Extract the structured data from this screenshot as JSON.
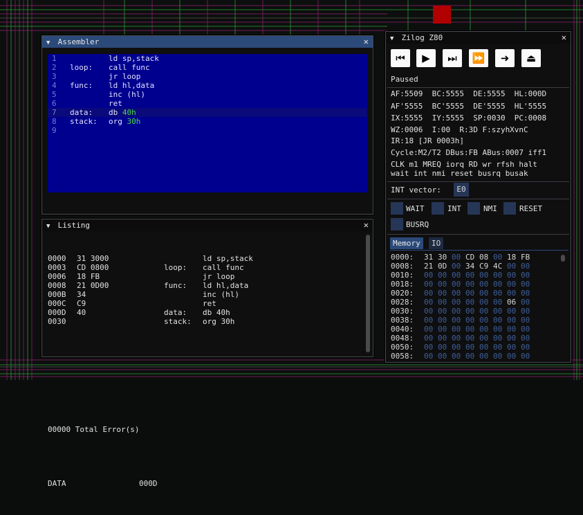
{
  "colors": {
    "title_active": "#2b4a7a",
    "editor_bg": "#00008f",
    "number": "#48d848",
    "zero_byte": "#3f5f9a"
  },
  "assembler": {
    "title": "Assembler",
    "lines": [
      {
        "n": "1",
        "label": "",
        "code": "ld sp,stack",
        "num": ""
      },
      {
        "n": "2",
        "label": "loop:",
        "code": "call func",
        "num": ""
      },
      {
        "n": "3",
        "label": "",
        "code": "jr loop",
        "num": ""
      },
      {
        "n": "4",
        "label": "func:",
        "code": "ld hl,data",
        "num": ""
      },
      {
        "n": "5",
        "label": "",
        "code": "inc (hl)",
        "num": ""
      },
      {
        "n": "6",
        "label": "",
        "code": "ret",
        "num": ""
      },
      {
        "n": "7",
        "label": "data:",
        "code": "db ",
        "num": "40h"
      },
      {
        "n": "8",
        "label": "stack:",
        "code": "org ",
        "num": "30h"
      },
      {
        "n": "9",
        "label": "",
        "code": "",
        "num": ""
      }
    ]
  },
  "listing": {
    "title": "Listing",
    "rows": [
      {
        "addr": "0000",
        "bytes": "31 3000",
        "label": "",
        "code": "ld sp,stack"
      },
      {
        "addr": "0003",
        "bytes": "CD 0800",
        "label": "loop:",
        "code": "call func"
      },
      {
        "addr": "0006",
        "bytes": "18 FB",
        "label": "",
        "code": "jr loop"
      },
      {
        "addr": "0008",
        "bytes": "21 0D00",
        "label": "func:",
        "code": "ld hl,data"
      },
      {
        "addr": "000B",
        "bytes": "34",
        "label": "",
        "code": "inc (hl)"
      },
      {
        "addr": "000C",
        "bytes": "C9",
        "label": "",
        "code": "ret"
      },
      {
        "addr": "000D",
        "bytes": "40",
        "label": "data:",
        "code": "db 40h"
      },
      {
        "addr": "0030",
        "bytes": "",
        "label": "stack:",
        "code": "org 30h"
      }
    ],
    "errors": "00000 Total Error(s)",
    "symbol": "DATA",
    "symbol_value": "000D"
  },
  "z80": {
    "title": "Zilog Z80",
    "buttons": [
      "⏮",
      "▶",
      "⏭",
      "⏩",
      "➜",
      "⏏"
    ],
    "status": "Paused",
    "regs": [
      "AF:5509  BC:5555  DE:5555  HL:000D",
      "AF'5555  BC'5555  DE'5555  HL'5555",
      "IX:5555  IY:5555  SP:0030  PC:0008",
      "WZ:0006  I:00  R:3D F:szyhXvnC"
    ],
    "ir": "IR:18 [JR 0003h]",
    "cycle": "Cycle:M2/T2 DBus:FB ABus:0007 iff1",
    "pins1": "CLK m1 MREQ iorq RD wr rfsh halt",
    "pins2": "wait int nmi reset busrq busak",
    "int_vector_label": "INT vector:",
    "int_vector_value": "E0",
    "checks": [
      "WAIT",
      "INT",
      "NMI",
      "RESET",
      "BUSRQ"
    ],
    "tabs": [
      "Memory",
      "IO"
    ],
    "memory": [
      {
        "addr": "0000:",
        "bytes": [
          "31",
          "30",
          "00",
          "CD",
          "08",
          "00",
          "18",
          "FB"
        ]
      },
      {
        "addr": "0008:",
        "bytes": [
          "21",
          "0D",
          "00",
          "34",
          "C9",
          "4C",
          "00",
          "00"
        ]
      },
      {
        "addr": "0010:",
        "bytes": [
          "00",
          "00",
          "00",
          "00",
          "00",
          "00",
          "00",
          "00"
        ]
      },
      {
        "addr": "0018:",
        "bytes": [
          "00",
          "00",
          "00",
          "00",
          "00",
          "00",
          "00",
          "00"
        ]
      },
      {
        "addr": "0020:",
        "bytes": [
          "00",
          "00",
          "00",
          "00",
          "00",
          "00",
          "00",
          "00"
        ]
      },
      {
        "addr": "0028:",
        "bytes": [
          "00",
          "00",
          "00",
          "00",
          "00",
          "00",
          "06",
          "00"
        ]
      },
      {
        "addr": "0030:",
        "bytes": [
          "00",
          "00",
          "00",
          "00",
          "00",
          "00",
          "00",
          "00"
        ]
      },
      {
        "addr": "0038:",
        "bytes": [
          "00",
          "00",
          "00",
          "00",
          "00",
          "00",
          "00",
          "00"
        ]
      },
      {
        "addr": "0040:",
        "bytes": [
          "00",
          "00",
          "00",
          "00",
          "00",
          "00",
          "00",
          "00"
        ]
      },
      {
        "addr": "0048:",
        "bytes": [
          "00",
          "00",
          "00",
          "00",
          "00",
          "00",
          "00",
          "00"
        ]
      },
      {
        "addr": "0050:",
        "bytes": [
          "00",
          "00",
          "00",
          "00",
          "00",
          "00",
          "00",
          "00"
        ]
      },
      {
        "addr": "0058:",
        "bytes": [
          "00",
          "00",
          "00",
          "00",
          "00",
          "00",
          "00",
          "00"
        ]
      }
    ]
  }
}
